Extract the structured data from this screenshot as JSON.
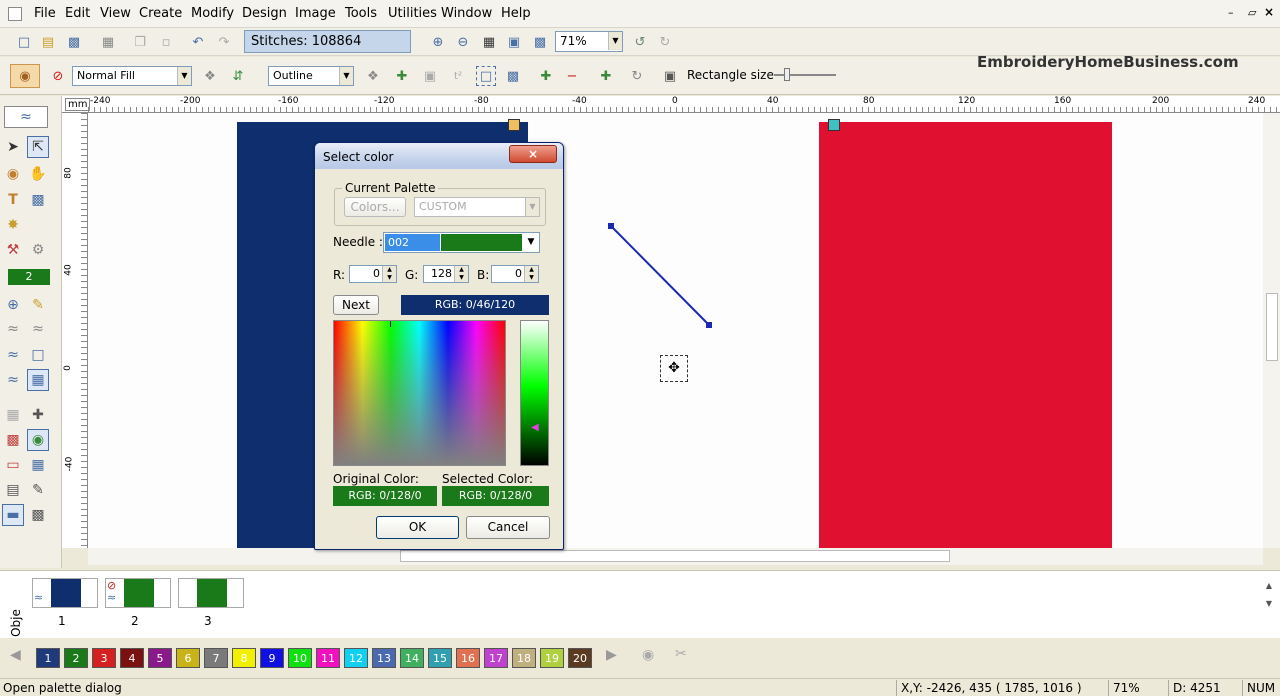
{
  "menu": [
    "File",
    "Edit",
    "View",
    "Create",
    "Modify",
    "Design",
    "Image",
    "Tools",
    "Utilities",
    "Window",
    "Help"
  ],
  "toolbar": {
    "stitches": "Stitches: 108864",
    "zoom": "71%",
    "fill": "Normal Fill",
    "outline": "Outline",
    "rect_size_label": "Rectangle size",
    "brand": "EmbroideryHomeBusiness.com"
  },
  "ruler": {
    "unit": "mm",
    "top_ticks": [
      "-240",
      "-200",
      "-160",
      "-120",
      "-80",
      "-40",
      "0",
      "40",
      "80",
      "120",
      "160",
      "200",
      "240"
    ],
    "left_ticks": [
      "80",
      "40",
      "0",
      "-40"
    ]
  },
  "left_toolbar": {
    "needle_number": "2"
  },
  "dialog": {
    "title": "Select color",
    "group_label": "Current Palette",
    "colors_button": "Colors...",
    "palette_value": "CUSTOM",
    "needle_label": "Needle :",
    "needle_value": "002",
    "r_label": "R:",
    "r_value": "0",
    "g_label": "G:",
    "g_value": "128",
    "b_label": "B:",
    "b_value": "0",
    "next_button": "Next",
    "rgb_preview": "RGB: 0/46/120",
    "original_label": "Original Color:",
    "original_value": "RGB: 0/128/0",
    "selected_label": "Selected Color:",
    "selected_value": "RGB: 0/128/0",
    "ok": "OK",
    "cancel": "Cancel"
  },
  "objects": {
    "panel_label": "Obje",
    "items": [
      {
        "number": "1"
      },
      {
        "number": "2"
      },
      {
        "number": "3"
      }
    ]
  },
  "palette": {
    "swatches": [
      {
        "n": "1",
        "c": "#1f3a7a"
      },
      {
        "n": "2",
        "c": "#1a7a1a"
      },
      {
        "n": "3",
        "c": "#d42020"
      },
      {
        "n": "4",
        "c": "#7a1010"
      },
      {
        "n": "5",
        "c": "#8a1a8a"
      },
      {
        "n": "6",
        "c": "#c8b418"
      },
      {
        "n": "7",
        "c": "#7a7a7a"
      },
      {
        "n": "8",
        "c": "#f0f000"
      },
      {
        "n": "9",
        "c": "#1010e0"
      },
      {
        "n": "10",
        "c": "#10e010"
      },
      {
        "n": "11",
        "c": "#f010c0"
      },
      {
        "n": "12",
        "c": "#10d0f0"
      },
      {
        "n": "13",
        "c": "#4a6ab0"
      },
      {
        "n": "14",
        "c": "#40b060"
      },
      {
        "n": "15",
        "c": "#30a0b0"
      },
      {
        "n": "16",
        "c": "#e07050"
      },
      {
        "n": "17",
        "c": "#c040d0"
      },
      {
        "n": "18",
        "c": "#c0b080"
      },
      {
        "n": "19",
        "c": "#b0d040"
      },
      {
        "n": "20",
        "c": "#5a3a20"
      }
    ]
  },
  "status": {
    "message": "Open palette dialog",
    "xy": "X,Y: -2426, 435  ( 1785, 1016 )",
    "zoom": "71%",
    "d": "D: 4251",
    "num": "NUM"
  }
}
